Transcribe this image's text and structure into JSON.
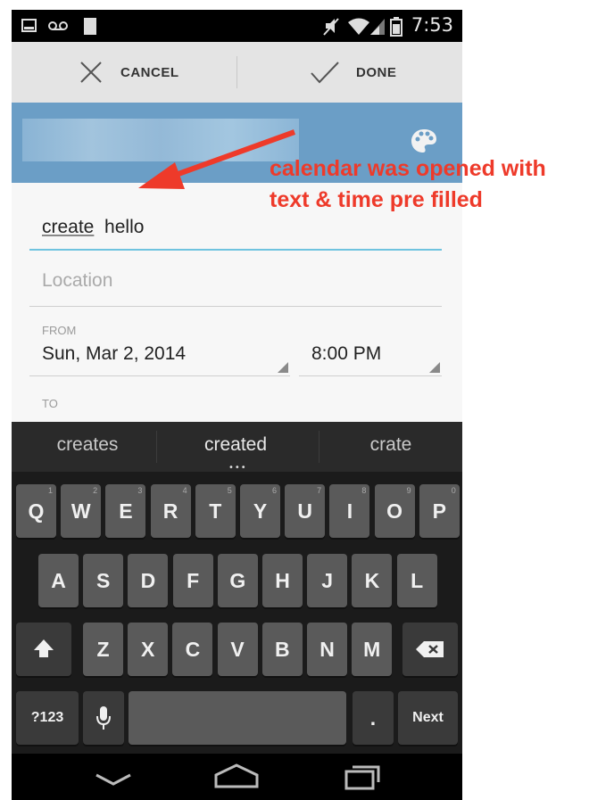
{
  "status_bar": {
    "time": "7:53"
  },
  "action_bar": {
    "cancel_label": "CANCEL",
    "done_label": "DONE"
  },
  "event_form": {
    "title_value_underlined": "create",
    "title_value_rest": "hello",
    "location_placeholder": "Location",
    "from_label": "FROM",
    "from_date": "Sun, Mar 2, 2014",
    "from_time": "8:00 PM",
    "to_label": "TO"
  },
  "keyboard": {
    "suggestions": [
      "creates",
      "created",
      "crate"
    ],
    "row1": [
      "Q",
      "W",
      "E",
      "R",
      "T",
      "Y",
      "U",
      "I",
      "O",
      "P"
    ],
    "row1_hints": [
      "1",
      "2",
      "3",
      "4",
      "5",
      "6",
      "7",
      "8",
      "9",
      "0"
    ],
    "row2": [
      "A",
      "S",
      "D",
      "F",
      "G",
      "H",
      "J",
      "K",
      "L"
    ],
    "row3": [
      "Z",
      "X",
      "C",
      "V",
      "B",
      "N",
      "M"
    ],
    "symbols_label": "?123",
    "period_label": ".",
    "next_label": "Next"
  },
  "annotation": {
    "line1": "calendar was opened with",
    "line2": "text & time pre filled",
    "color": "#ee3a2a"
  },
  "colors": {
    "calendar_color": "#6b9ec6",
    "focus_underline": "#6fc3df"
  }
}
